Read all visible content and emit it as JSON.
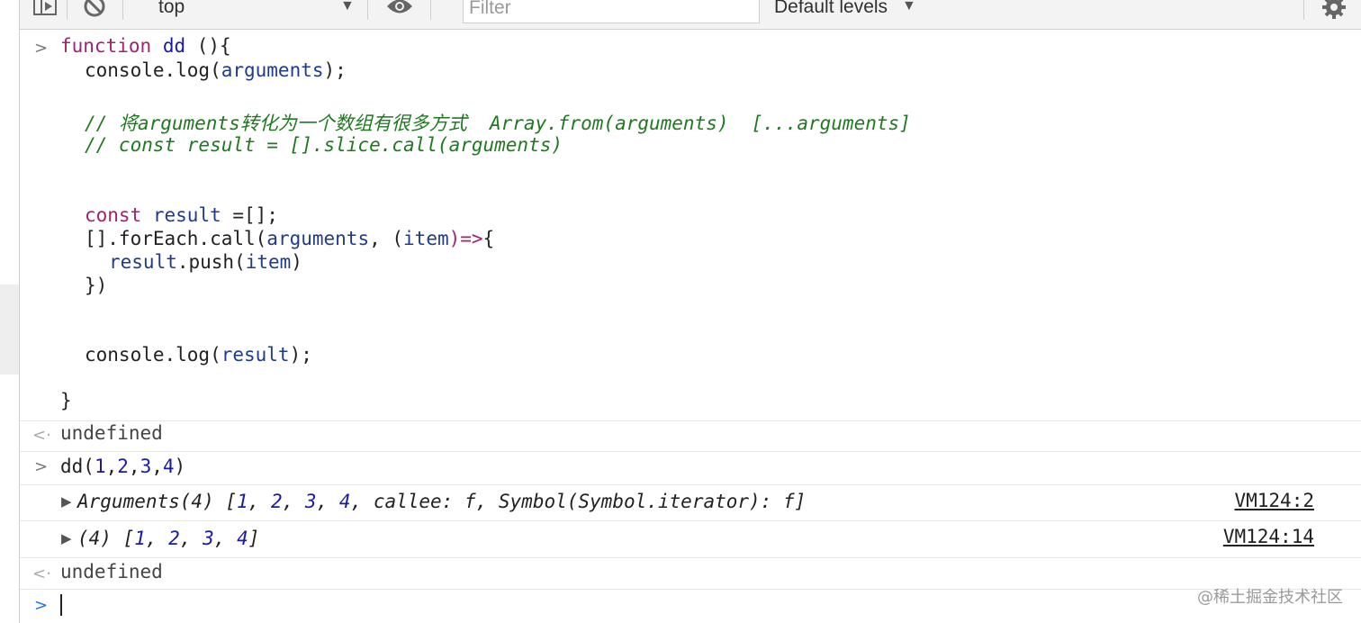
{
  "toolbar": {
    "context": "top",
    "filter_placeholder": "Filter",
    "levels": "Default levels"
  },
  "input_code": {
    "line1_kw": "function",
    "line1_name": "dd",
    "line1_rest": " (){",
    "line2_obj": "console.log(",
    "line2_arg": "arguments",
    "line2_end": ");",
    "comment1": "// 将arguments转化为一个数组有很多方式  Array.from(arguments)  [...arguments]",
    "comment2": "// const result = [].slice.call(arguments)",
    "line3_kw": "const",
    "line3_var": "result",
    "line3_rest": " =[];",
    "line4_pre": "[].forEach.call(",
    "line4_arg": "arguments",
    "line4_mid": ", (",
    "line4_item": "item",
    "line4_arrow": ")=>",
    "line4_brace": "{",
    "line5_var": "result",
    "line5_mid": ".push(",
    "line5_item": "item",
    "line5_end": ")",
    "line6": "})",
    "line7_pre": "console.log(",
    "line7_var": "result",
    "line7_end": ");",
    "line8": "}"
  },
  "output1": "undefined",
  "call": {
    "name": "dd(",
    "n1": "1",
    "n2": "2",
    "n3": "3",
    "n4": "4",
    "end": ")"
  },
  "log1": {
    "label": "Arguments(4) [",
    "n1": "1",
    "n2": "2",
    "n3": "3",
    "n4": "4",
    "tail": ", callee: f, Symbol(Symbol.iterator): f]",
    "source": "VM124:2"
  },
  "log2": {
    "label": "(4) [",
    "n1": "1",
    "n2": "2",
    "n3": "3",
    "n4": "4",
    "tail": "]",
    "source": "VM124:14"
  },
  "output2": "undefined",
  "watermark": "@稀土掘金技术社区"
}
